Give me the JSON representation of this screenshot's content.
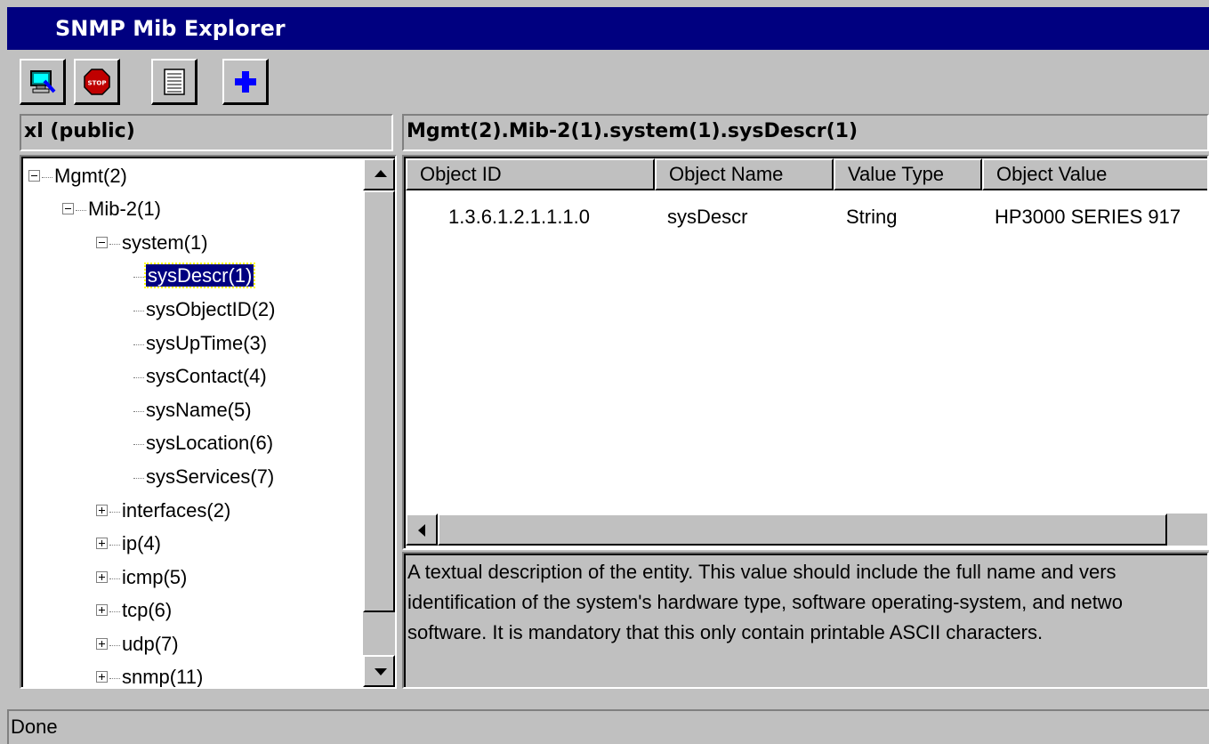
{
  "window": {
    "title": "SNMP Mib Explorer"
  },
  "toolbar": {
    "buttons": [
      {
        "name": "connect-icon"
      },
      {
        "name": "stop-icon",
        "label": "STOP"
      },
      {
        "name": "list-icon"
      },
      {
        "name": "add-icon"
      }
    ]
  },
  "tree_panel": {
    "header": "xl (public)",
    "nodes": [
      {
        "label": "Mgmt(2)",
        "state": "expanded"
      },
      {
        "label": "Mib-2(1)",
        "state": "expanded"
      },
      {
        "label": "system(1)",
        "state": "expanded"
      },
      {
        "label": "sysDescr(1)",
        "state": "leaf",
        "selected": true
      },
      {
        "label": "sysObjectID(2)",
        "state": "leaf"
      },
      {
        "label": "sysUpTime(3)",
        "state": "leaf"
      },
      {
        "label": "sysContact(4)",
        "state": "leaf"
      },
      {
        "label": "sysName(5)",
        "state": "leaf"
      },
      {
        "label": "sysLocation(6)",
        "state": "leaf"
      },
      {
        "label": "sysServices(7)",
        "state": "leaf"
      },
      {
        "label": "interfaces(2)",
        "state": "collapsed"
      },
      {
        "label": "ip(4)",
        "state": "collapsed"
      },
      {
        "label": "icmp(5)",
        "state": "collapsed"
      },
      {
        "label": "tcp(6)",
        "state": "collapsed"
      },
      {
        "label": "udp(7)",
        "state": "collapsed"
      },
      {
        "label": "snmp(11)",
        "state": "collapsed"
      }
    ]
  },
  "detail_panel": {
    "path": "Mgmt(2).Mib-2(1).system(1).sysDescr(1)",
    "columns": [
      "Object ID",
      "Object Name",
      "Value Type",
      "Object Value"
    ],
    "rows": [
      [
        "1.3.6.1.2.1.1.1.0",
        "sysDescr",
        "String",
        "HP3000 SERIES 917"
      ]
    ],
    "description": [
      "A textual description of the entity. This value should include the full name and vers",
      "identification of the system's hardware type, software operating-system, and netwo",
      "software. It is mandatory that this only contain printable ASCII characters."
    ]
  },
  "status_bar": {
    "text": "Done"
  },
  "colors": {
    "title_bar": "#000080",
    "face": "#c0c0c0",
    "selection": "#000080"
  }
}
